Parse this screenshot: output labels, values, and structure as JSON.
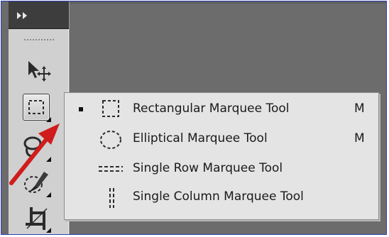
{
  "flyout_menu": {
    "items": [
      {
        "label": "Rectangular Marquee Tool",
        "shortcut": "M",
        "selected": true,
        "icon": "rectangular-marquee-icon"
      },
      {
        "label": "Elliptical Marquee Tool",
        "shortcut": "M",
        "selected": false,
        "icon": "elliptical-marquee-icon"
      },
      {
        "label": "Single Row Marquee Tool",
        "shortcut": "",
        "selected": false,
        "icon": "single-row-marquee-icon"
      },
      {
        "label": "Single Column Marquee Tool",
        "shortcut": "",
        "selected": false,
        "icon": "single-column-marquee-icon"
      }
    ]
  },
  "toolbox": {
    "tools": [
      "move-tool-icon",
      "rectangular-marquee-icon",
      "lasso-icon",
      "quick-selection-icon",
      "crop-icon"
    ]
  },
  "colors": {
    "annotation_arrow": "#d01c1c",
    "workspace": "#6b6b6b",
    "panel": "#d0d0d0",
    "menu_bg": "#e4e4e4"
  }
}
